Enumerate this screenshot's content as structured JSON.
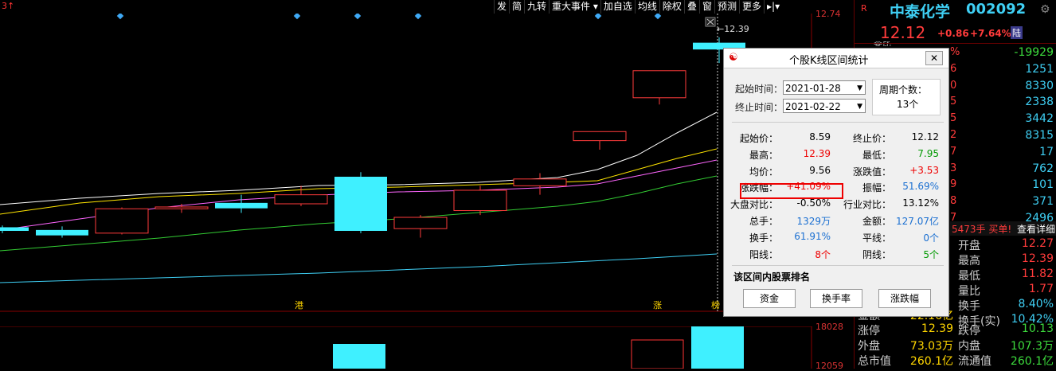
{
  "toolbar": {
    "items": [
      "发",
      "简",
      "九转",
      "重大事件 ▾",
      "加自选",
      "均线",
      "除权",
      "叠",
      "窗",
      "预测",
      "更多",
      "▸|▾"
    ]
  },
  "chart": {
    "prev_label": "3↑",
    "annotation_high": "←12.39",
    "bottom_marks": [
      "港",
      "涨",
      "榜"
    ],
    "candles": [
      {
        "o": 8.1,
        "c": 8.18,
        "h": 8.22,
        "l": 8.05,
        "color": "cyan"
      },
      {
        "o": 8.0,
        "c": 8.12,
        "h": 8.2,
        "l": 7.95,
        "color": "cyan"
      },
      {
        "o": 8.59,
        "c": 8.05,
        "h": 8.62,
        "l": 8.02,
        "color": "red"
      },
      {
        "o": 8.59,
        "c": 8.63,
        "h": 8.7,
        "l": 8.5,
        "color": "red"
      },
      {
        "o": 8.72,
        "c": 8.6,
        "h": 8.9,
        "l": 8.5,
        "color": "cyan"
      },
      {
        "o": 8.7,
        "c": 8.9,
        "h": 9.1,
        "l": 8.65,
        "color": "red"
      },
      {
        "o": 9.3,
        "c": 8.1,
        "h": 9.4,
        "l": 8.05,
        "color": "cyan"
      },
      {
        "o": 8.15,
        "c": 8.4,
        "h": 8.45,
        "l": 7.95,
        "color": "red"
      },
      {
        "o": 8.55,
        "c": 9.0,
        "h": 9.1,
        "l": 8.45,
        "color": "red"
      },
      {
        "o": 9.1,
        "c": 9.25,
        "h": 9.38,
        "l": 8.9,
        "color": "red"
      },
      {
        "o": 10.1,
        "c": 10.3,
        "h": 10.3,
        "l": 9.9,
        "color": "red"
      },
      {
        "o": 11.05,
        "c": 11.65,
        "h": 11.65,
        "l": 10.9,
        "color": "red"
      },
      {
        "o": 12.27,
        "c": 12.12,
        "h": 12.39,
        "l": 11.82,
        "color": "cyan"
      }
    ]
  },
  "axis": {
    "top": "12.74",
    "vol_top": "18028",
    "vol_bottom": "12059"
  },
  "stock": {
    "mark": "R",
    "name": "中泰化学",
    "code": "002092",
    "price": "12.12",
    "change": "+0.86",
    "pct": "+7.64%",
    "tag": "陆",
    "cut": "委比"
  },
  "quote_rows": [
    {
      "l": "%",
      "v": "-19929",
      "vc": "green"
    },
    {
      "l": "6",
      "v": "1251",
      "vc": "cyan"
    },
    {
      "l": "0",
      "v": "8330",
      "vc": "cyan"
    },
    {
      "l": "5",
      "v": "2338",
      "vc": "cyan"
    },
    {
      "l": "5",
      "v": "3442",
      "vc": "cyan"
    },
    {
      "l": "2",
      "v": "8315",
      "vc": "cyan"
    },
    {
      "l": "7",
      "v": "17",
      "vc": "cyan"
    },
    {
      "l": "3",
      "v": "762",
      "vc": "cyan"
    },
    {
      "l": "9",
      "v": "101",
      "vc": "cyan"
    },
    {
      "l": "8",
      "v": "371",
      "vc": "cyan"
    },
    {
      "l": "7",
      "v": "2496",
      "vc": "cyan"
    }
  ],
  "trade_bar": {
    "left": "5473手 买单!",
    "right": "查看详细"
  },
  "stats_rows": [
    {
      "k": "开盘",
      "v": "12.27",
      "vc": "red"
    },
    {
      "k": "最高",
      "v": "12.39",
      "vc": "red"
    },
    {
      "k": "最低",
      "v": "11.82",
      "vc": "red"
    },
    {
      "k": "量比",
      "v": "1.77",
      "vc": "red"
    },
    {
      "k": "换手",
      "v": "8.40%",
      "vc": "cyan"
    },
    {
      "k": "换手(实)",
      "v": "10.42%",
      "vc": "cyan"
    }
  ],
  "bottom_rows": [
    {
      "a": "金额",
      "b": "22.16亿",
      "k": "",
      "v": ""
    },
    {
      "a": "涨停",
      "b": "12.39",
      "k": "跌停",
      "v": "10.13"
    },
    {
      "a": "外盘",
      "b": "73.03万",
      "k": "内盘",
      "v": "107.3万"
    },
    {
      "a": "总市值",
      "b": "260.1亿",
      "k": "流通值",
      "v": "260.1亿"
    }
  ],
  "dialog": {
    "title": "个股K线区间统计",
    "start_label": "起始时间：",
    "start_date": "2021-01-28",
    "end_label": "终止时间：",
    "end_date": "2021-02-22",
    "period_label": "周期个数：",
    "period_value": "13个",
    "rows": [
      {
        "l1": "起始价：",
        "v1": "8.59",
        "c1": "black",
        "l2": "终止价：",
        "v2": "12.12",
        "c2": "black"
      },
      {
        "l1": "最高：",
        "v1": "12.39",
        "c1": "red",
        "l2": "最低：",
        "v2": "7.95",
        "c2": "green"
      },
      {
        "l1": "均价：",
        "v1": "9.56",
        "c1": "black",
        "l2": "涨跌值：",
        "v2": "+3.53",
        "c2": "red"
      },
      {
        "l1": "涨跌幅：",
        "v1": "+41.09%",
        "c1": "red",
        "l2": "振幅：",
        "v2": "51.69%",
        "c2": "blue"
      },
      {
        "l1": "大盘对比：",
        "v1": "-0.50%",
        "c1": "black",
        "l2": "行业对比：",
        "v2": "13.12%",
        "c2": "black"
      },
      {
        "l1": "总手：",
        "v1": "1329万",
        "c1": "blue",
        "l2": "金额：",
        "v2": "127.07亿",
        "c2": "blue"
      },
      {
        "l1": "换手：",
        "v1": "61.91%",
        "c1": "blue",
        "l2": "平线：",
        "v2": "0个",
        "c2": "blue"
      },
      {
        "l1": "阳线：",
        "v1": "8个",
        "c1": "red",
        "l2": "阴线：",
        "v2": "5个",
        "c2": "green"
      }
    ],
    "rank_title": "该区间内股票排名",
    "buttons": [
      "资金",
      "换手率",
      "涨跌幅"
    ]
  }
}
